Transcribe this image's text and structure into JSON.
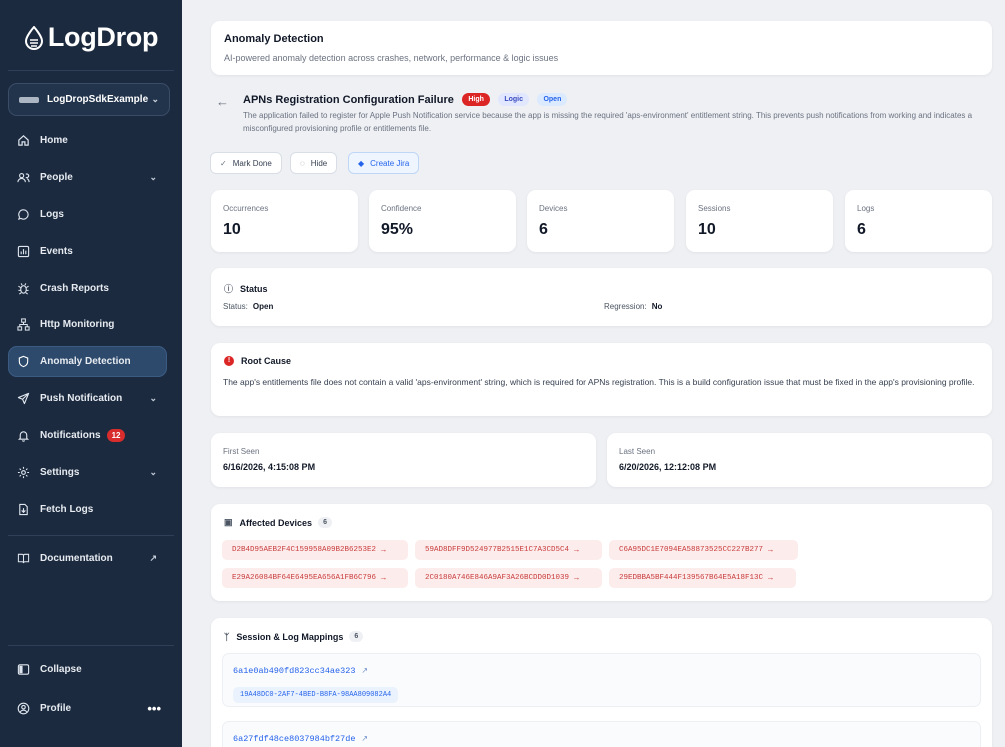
{
  "brand": {
    "name": "LogDrop"
  },
  "app_selector": {
    "value": "LogDropSdkExample"
  },
  "nav": {
    "home": "Home",
    "people": "People",
    "logs": "Logs",
    "events": "Events",
    "crash_reports": "Crash Reports",
    "http_monitoring": "Http Monitoring",
    "anomaly_detection": "Anomaly Detection",
    "push_notification": "Push Notification",
    "notifications": "Notifications",
    "notifications_badge": "12",
    "settings": "Settings",
    "fetch_logs": "Fetch Logs",
    "documentation": "Documentation",
    "collapse": "Collapse",
    "profile": "Profile"
  },
  "page_header": {
    "title": "Anomaly Detection",
    "subtitle": "AI-powered anomaly detection across crashes, network, performance & logic issues"
  },
  "anomaly": {
    "title": "APNs Registration Configuration Failure",
    "tags": {
      "severity": "High",
      "category": "Logic",
      "state": "Open"
    },
    "description": "The application failed to register for Apple Push Notification service because the app is missing the required 'aps-environment' entitlement string. This prevents push notifications from working and indicates a misconfigured provisioning profile or entitlements file."
  },
  "actions": {
    "mark_done": "Mark Done",
    "hide": "Hide",
    "create_jira": "Create Jira"
  },
  "stats": [
    {
      "label": "Occurrences",
      "value": "10"
    },
    {
      "label": "Confidence",
      "value": "95%"
    },
    {
      "label": "Devices",
      "value": "6"
    },
    {
      "label": "Sessions",
      "value": "10"
    },
    {
      "label": "Logs",
      "value": "6"
    }
  ],
  "status": {
    "heading": "Status",
    "status_label": "Status:",
    "status_value": "Open",
    "regression_label": "Regression:",
    "regression_value": "No"
  },
  "root_cause": {
    "heading": "Root Cause",
    "text": "The app's entitlements file does not contain a valid 'aps-environment' string, which is required for APNs registration. This is a build configuration issue that must be fixed in the app's provisioning profile."
  },
  "seen": {
    "first_label": "First Seen",
    "first_value": "6/16/2026, 4:15:08 PM",
    "last_label": "Last Seen",
    "last_value": "6/20/2026, 12:12:08 PM"
  },
  "affected_devices": {
    "heading": "Affected Devices",
    "count": "6",
    "ids": [
      "D2B4D95AEB2F4C159958A09B2B6253E2",
      "59AD8DFF9D524977B2515E1C7A3CD5C4",
      "C6A95DC1E7094EA58873525CC227B277",
      "E29A26084BF64E6495EA656A1FB6C796",
      "2C0180A746E846A9AF3A26BCDD0D1039",
      "29EDBBA5BF444F139567B64E5A18F13C"
    ]
  },
  "mappings": {
    "heading": "Session & Log Mappings",
    "count": "6",
    "items": [
      {
        "session": "6a1e0ab490fd823cc34ae323",
        "log": "19A48DC0-2AF7-4BED-B8FA-98AA809082A4"
      },
      {
        "session": "6a27fdf48ce8037984bf27de"
      }
    ]
  },
  "colors": {
    "sidebar_bg": "#1b2a3e",
    "active_nav": "#2d4a6c",
    "accent": "#2563eb",
    "danger": "#dc2626"
  }
}
